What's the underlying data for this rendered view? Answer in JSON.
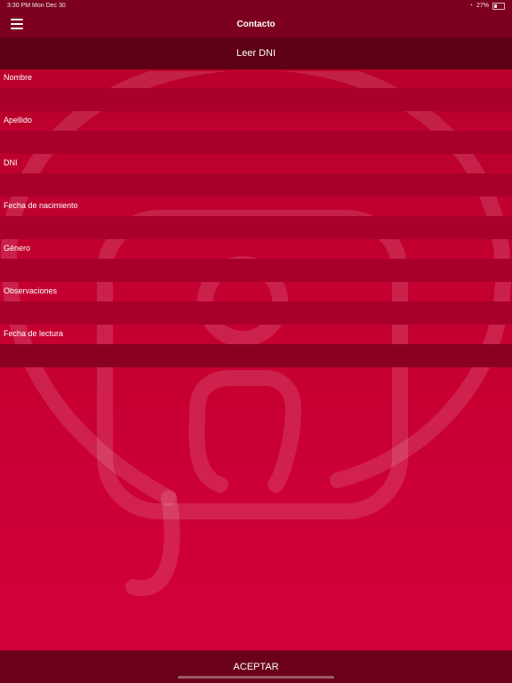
{
  "status_bar": {
    "time_date": "3:30 PM   Mon Dec 30",
    "wifi_icon": "wifi-icon",
    "battery_text": "27%"
  },
  "nav": {
    "title": "Contacto",
    "menu_icon": "hamburger-menu-icon"
  },
  "read_dni": {
    "label": "Leer DNI"
  },
  "form": {
    "fields": [
      {
        "label": "Nombre",
        "value": ""
      },
      {
        "label": "Apellido",
        "value": ""
      },
      {
        "label": "DNI",
        "value": ""
      },
      {
        "label": "Fecha de nacimiento",
        "value": ""
      },
      {
        "label": "Género",
        "value": ""
      },
      {
        "label": "Observaciones",
        "value": ""
      },
      {
        "label": "Fecha de lectura",
        "value": ""
      }
    ]
  },
  "footer": {
    "accept_label": "ACEPTAR"
  },
  "colors": {
    "bar_dark": "#7d0022",
    "background": "#c40030",
    "field": "#a8002a"
  }
}
